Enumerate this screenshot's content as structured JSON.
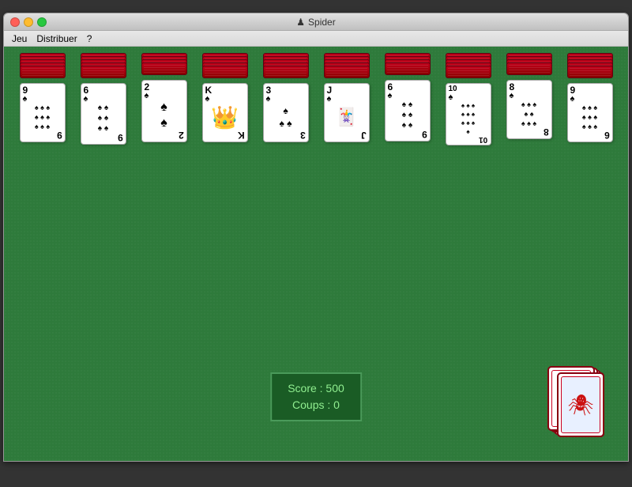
{
  "window": {
    "title": "Spider",
    "title_icon": "♟"
  },
  "menu": {
    "items": [
      "Jeu",
      "Distribuer",
      "?"
    ]
  },
  "columns": [
    {
      "id": 0,
      "face_down_count": 5,
      "visible_card": {
        "rank": "9",
        "suit": "♠",
        "pips": [
          "♠",
          "♠",
          "♠",
          "♠",
          "♠",
          "♠",
          "♠",
          "♠",
          "♠"
        ]
      }
    },
    {
      "id": 1,
      "face_down_count": 5,
      "visible_card": {
        "rank": "6",
        "suit": "♠",
        "pips": [
          "♠",
          "♠",
          "♠",
          "♠",
          "♠",
          "♠"
        ]
      }
    },
    {
      "id": 2,
      "face_down_count": 4,
      "visible_card": {
        "rank": "2",
        "suit": "♠",
        "pips": [
          "♠",
          "♠"
        ]
      }
    },
    {
      "id": 3,
      "face_down_count": 5,
      "visible_card": {
        "rank": "K",
        "suit": "♠",
        "is_king": true
      }
    },
    {
      "id": 4,
      "face_down_count": 5,
      "visible_card": {
        "rank": "3",
        "suit": "♠",
        "pips": [
          "♠",
          "♠",
          "♠"
        ]
      }
    },
    {
      "id": 5,
      "face_down_count": 5,
      "visible_card": {
        "rank": "J",
        "suit": "♠",
        "is_jack": true
      }
    },
    {
      "id": 6,
      "face_down_count": 4,
      "visible_card": {
        "rank": "6",
        "suit": "♠",
        "pips": [
          "♠",
          "♠",
          "♠",
          "♠",
          "♠",
          "♠"
        ]
      }
    },
    {
      "id": 7,
      "face_down_count": 5,
      "visible_card": {
        "rank": "10",
        "suit": "♠",
        "pips": [
          "♠",
          "♠",
          "♠",
          "♠",
          "♠",
          "♠",
          "♠",
          "♠",
          "♠",
          "♠"
        ]
      }
    },
    {
      "id": 8,
      "face_down_count": 4,
      "visible_card": {
        "rank": "8",
        "suit": "♠",
        "pips": [
          "♠",
          "♠",
          "♠",
          "♠",
          "♠",
          "♠",
          "♠",
          "♠"
        ]
      }
    },
    {
      "id": 9,
      "face_down_count": 5,
      "visible_card": {
        "rank": "9",
        "suit": "♠",
        "pips": [
          "♠",
          "♠",
          "♠",
          "♠",
          "♠",
          "♠",
          "♠",
          "♠",
          "♠"
        ]
      }
    }
  ],
  "score": {
    "label_score": "Score : ",
    "value_score": "500",
    "label_coups": "Coups : ",
    "value_coups": "0",
    "line1": "Score :  500",
    "line2": "Coups :  0"
  },
  "deck": {
    "cards_remaining": 5
  }
}
